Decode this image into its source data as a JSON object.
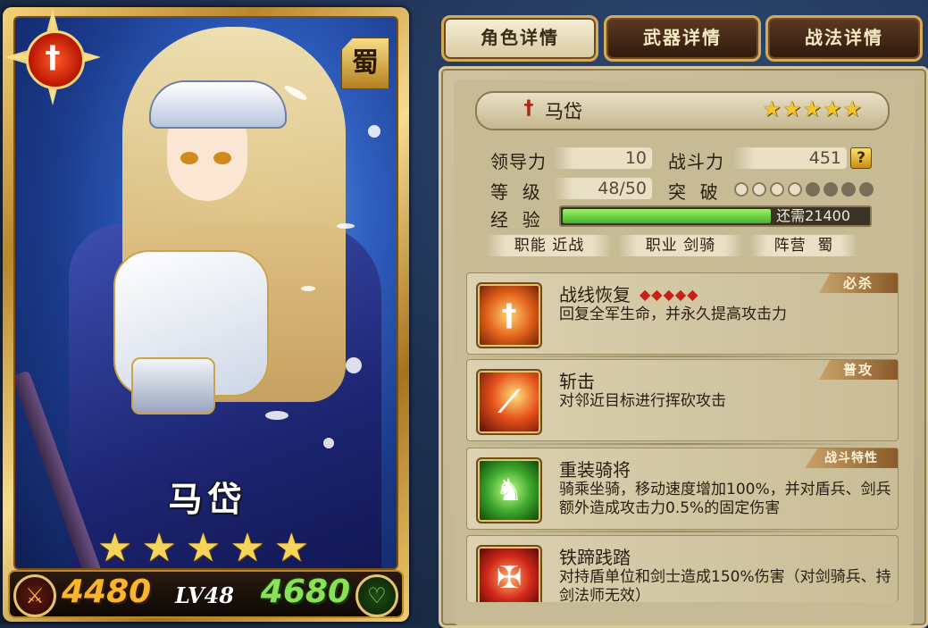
{
  "tabs": [
    {
      "label": "角色详情",
      "active": true
    },
    {
      "label": "武器详情",
      "active": false
    },
    {
      "label": "战法详情",
      "active": false
    }
  ],
  "card": {
    "name": "马岱",
    "stars": "★★★★★",
    "kingdom": "蜀",
    "faction_icon": "sword-emblem-icon",
    "attack": "4480",
    "level": "LV48",
    "hp": "4680"
  },
  "hero": {
    "name": "马岱",
    "stars": "★★★★★",
    "stats": {
      "leadership_label": "领导力",
      "leadership": "10",
      "power_label": "战斗力",
      "power": "451",
      "level_label": "等  级",
      "level": "48/50",
      "breakthrough_label": "突  破",
      "breakthrough_filled": 4,
      "breakthrough_total": 8,
      "exp_label": "经  验",
      "exp_progress": 0.68,
      "exp_text": "还需21400"
    },
    "tags": {
      "role": "职能 近战",
      "job": "职业 剑骑",
      "camp": "阵营  蜀"
    }
  },
  "skills": [
    {
      "name": "战线恢复",
      "desc": "回复全军生命，并永久提高攻击力",
      "tag": "必杀",
      "diamonds": "◆◆◆◆◆",
      "icon": "sword-burst-icon"
    },
    {
      "name": "斩击",
      "desc": "对邻近目标进行挥砍攻击",
      "tag": "普攻",
      "icon": "slash-icon"
    },
    {
      "name": "重装骑将",
      "desc": "骑乘坐骑，移动速度增加100%，并对盾兵、剑兵额外造成攻击力0.5%的固定伤害",
      "tag": "战斗特性",
      "icon": "horse-icon"
    },
    {
      "name": "铁蹄践踏",
      "desc": "对持盾单位和剑士造成150%伤害（对剑骑兵、持剑法师无效）",
      "icon": "hoof-shield-icon"
    }
  ],
  "colors": {
    "accent_gold": "#d5a95a",
    "exp_green": "#46b22a",
    "attack_orange": "#f8b62c",
    "hp_green": "#8be05a"
  }
}
